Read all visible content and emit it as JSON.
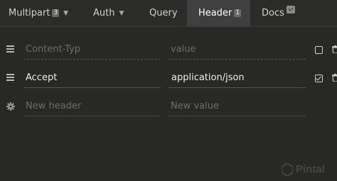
{
  "tabs": [
    {
      "label": "Multipart",
      "badge": "3",
      "caret": "▼"
    },
    {
      "label": "Auth",
      "caret": "▼"
    },
    {
      "label": "Query"
    },
    {
      "label": "Header",
      "badge": "1",
      "active": true
    },
    {
      "label": "Docs",
      "badge_icon": "check-icon"
    }
  ],
  "headers": [
    {
      "name_placeholder": "Content-Typ",
      "value_placeholder": "value",
      "enabled": false
    },
    {
      "name": "Accept",
      "value": "application/json",
      "enabled": true
    }
  ],
  "new_row": {
    "name_placeholder": "New header",
    "value_placeholder": "New value"
  },
  "watermark": {
    "text": "Pintal"
  },
  "colors": {
    "background": "#282826",
    "active_tab": "#3f3f3f",
    "text": "#e6e6e6",
    "placeholder": "#6c6c6c"
  }
}
